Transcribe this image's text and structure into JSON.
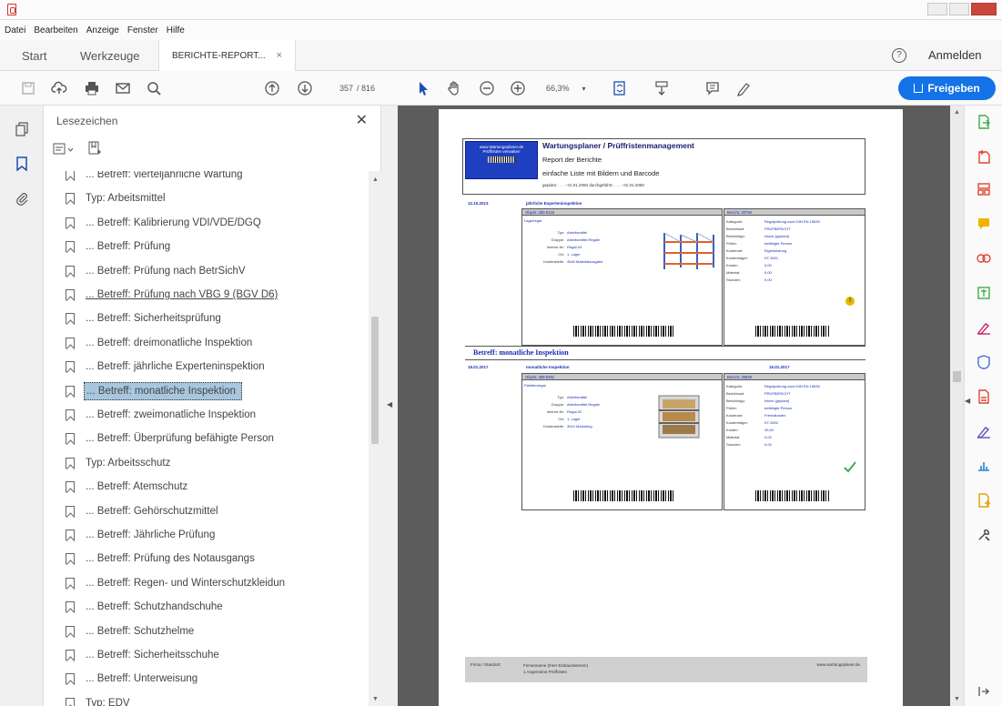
{
  "menu": [
    "Datei",
    "Bearbeiten",
    "Anzeige",
    "Fenster",
    "Hilfe"
  ],
  "tabs": {
    "start": "Start",
    "tools": "Werkzeuge",
    "document": "BERICHTE-REPORT...",
    "close": "×"
  },
  "header": {
    "signin": "Anmelden",
    "share": "Freigeben"
  },
  "toolbar": {
    "page_current": "357",
    "page_total": "/ 816",
    "zoom": "66,3%"
  },
  "bookmarks": {
    "title": "Lesezeichen",
    "items": [
      {
        "label": "... Betreff: vierteljährliche Wartung",
        "style": "cut"
      },
      {
        "label": "Typ: Arbeitsmittel",
        "style": ""
      },
      {
        "label": "... Betreff: Kalibrierung VDI/VDE/DGQ",
        "style": ""
      },
      {
        "label": "... Betreff: Prüfung",
        "style": ""
      },
      {
        "label": "... Betreff: Prüfung nach BetrSichV",
        "style": ""
      },
      {
        "label": "... Betreff: Prüfung nach VBG 9 (BGV D6)",
        "style": "underline"
      },
      {
        "label": "... Betreff: Sicherheitsprüfung",
        "style": ""
      },
      {
        "label": "... Betreff: dreimonatliche Inspektion",
        "style": ""
      },
      {
        "label": "... Betreff: jährliche Experteninspektion",
        "style": ""
      },
      {
        "label": "... Betreff: monatliche Inspektion",
        "style": "selected"
      },
      {
        "label": "... Betreff: zweimonatliche Inspektion",
        "style": ""
      },
      {
        "label": "... Betreff: Überprüfung befähigte Person",
        "style": ""
      },
      {
        "label": "Typ: Arbeitsschutz",
        "style": ""
      },
      {
        "label": "... Betreff: Atemschutz",
        "style": ""
      },
      {
        "label": "... Betreff: Gehörschutzmittel",
        "style": ""
      },
      {
        "label": "... Betreff: Jährliche Prüfung",
        "style": ""
      },
      {
        "label": "... Betreff: Prüfung des Notausgangs",
        "style": ""
      },
      {
        "label": "... Betreff: Regen- und Winterschutzkleidun",
        "style": ""
      },
      {
        "label": "... Betreff: Schutzhandschuhe",
        "style": ""
      },
      {
        "label": "... Betreff: Schutzhelme",
        "style": ""
      },
      {
        "label": "... Betreff: Sicherheitsschuhe",
        "style": ""
      },
      {
        "label": "... Betreff: Unterweisung",
        "style": ""
      },
      {
        "label": "Typ: EDV",
        "style": "cut"
      }
    ]
  },
  "report": {
    "logo_line1": "www.Wartungsplaner.de",
    "logo_line2": "Prüffristen verwalten",
    "title": "Wartungsplaner / Prüffristenmanagement",
    "subtitle1": "Report der Berichte",
    "subtitle2": "einfache Liste mit Bildern und Barcode",
    "meta": "geplant:  . . . - 01.01.2050  durchgeführt:  . . . - 01.01.2050",
    "entry1": {
      "date": "12.10.2013",
      "subject": "jährliche Experteninspektion",
      "object_hdr": "Objekt: 360-6315",
      "object_name": "Lagerregal",
      "labels": "Typ:\nGruppe:\nInterne-Nr:\nOrt:\nKostenstelle:",
      "values": "Arbeitsmittel\nArbeitsmittel-Regale\nRegal-04\n1. Lager\n4540 Materialausgabe",
      "report_hdr": "Bericht:  30794",
      "rep_labels": "Kategorie:\nBerichtsart:\nBerichtstyp:\nPrüfer:\nKostenart:\nKostenträger:\nKosten:\nMaterial:\nStunden:",
      "rep_values": "Regalprüfung nach DIN EN 15635\nPRÜFBERICHT\nIntern (geplant)\nbefähigte Person\nEigenleistung\nKT-3001\n0,00\n0,00\n0,00"
    },
    "section2": "Betreff: monatliche Inspektion",
    "entry2": {
      "date": "15.01.2017",
      "subject": "monatliche Inspektion",
      "date_right": "15.01.2017",
      "object_hdr": "Objekt: 369-6352",
      "object_name": "Palettenregal",
      "labels": "Typ:\nGruppe:\nInterne-Nr:\nOrt:\nKostenstelle:",
      "values": "Arbeitsmittel\nArbeitsmittel-Regale\nRegal-02\n1. Lager\n3510 Marketing",
      "report_hdr": "Bericht:  30849",
      "rep_labels": "Kategorie:\nBerichtsart:\nBerichtstyp:\nPrüfer:\nKostenart:\nKostenträger:\nKosten:\nMaterial:\nStunden:",
      "rep_values": "Regalprüfung nach DIN EN 15635\nPRÜFBERICHT\nIntern (geplant)\nbefähigte Person\nFremdkosten\nKT-3002\n45,00\n0,00\n0,00"
    },
    "footer_left": "Firma / Standort:",
    "footer_mid": "Firmenname (Ihrer Einbauzeitenen)\n1 Angemeine Prüffristen",
    "footer_right": "www.wartungsplaner.de"
  }
}
